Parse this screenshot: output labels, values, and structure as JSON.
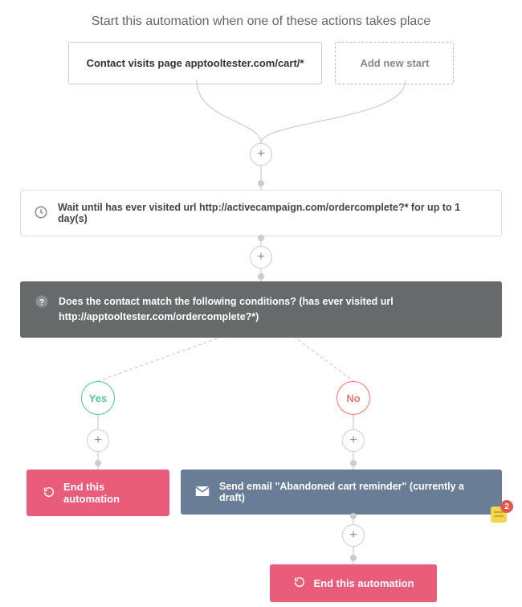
{
  "heading": "Start this automation when one of these actions takes place",
  "start": {
    "trigger_label": "Contact visits page apptooltester.com/cart/*",
    "add_new_label": "Add new start"
  },
  "wait": {
    "text": "Wait until has ever visited url http://activecampaign.com/ordercomplete?* for up to 1 day(s)"
  },
  "condition": {
    "text": "Does the contact match the following conditions? (has ever visited url http://apptooltester.com/ordercomplete?*)"
  },
  "branches": {
    "yes_label": "Yes",
    "no_label": "No"
  },
  "actions": {
    "end_automation_label": "End this automation",
    "send_email_label": "Send email \"Abandoned cart reminder\" (currently a draft)"
  },
  "plus_glyph": "+",
  "badge_count": "2"
}
